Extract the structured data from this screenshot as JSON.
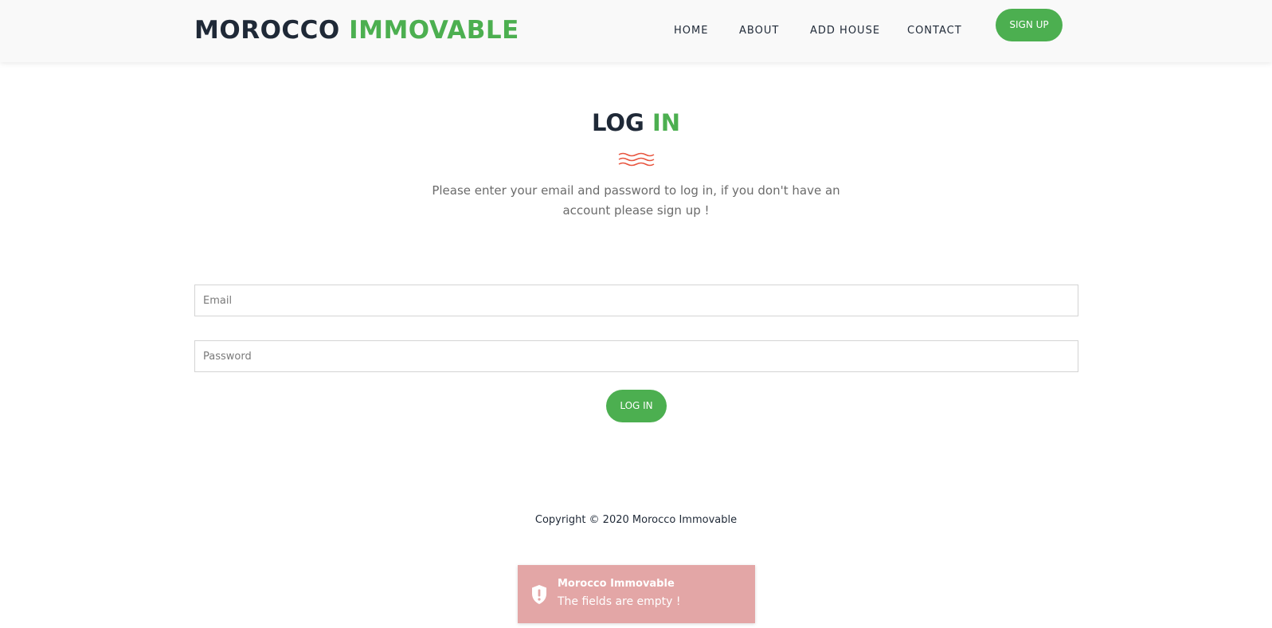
{
  "header": {
    "brand_part1": "MOROCCO",
    "brand_part2": "IMMOVABLE",
    "nav": {
      "home": "HOME",
      "about": "ABOUT",
      "add_house": "ADD HOUSE",
      "contact": "CONTACT"
    },
    "signup_label": "SIGN UP"
  },
  "main": {
    "title_part1": "LOG",
    "title_part2": "IN",
    "divider_icon": "wave-divider-icon",
    "subtitle": "Please enter your email and password to log in, if you don't have an account please sign up !",
    "email": {
      "value": "",
      "placeholder": "Email"
    },
    "password": {
      "value": "",
      "placeholder": "Password"
    },
    "login_label": "LOG IN"
  },
  "footer": {
    "copyright": "Copyright © 2020 Morocco Immovable"
  },
  "toast": {
    "icon": "shield-alert-icon",
    "title": "Morocco Immovable",
    "message": "The fields are empty !"
  },
  "colors": {
    "accent": "#4caf50",
    "dark": "#1f2937",
    "toast_bg": "#e3a6a6",
    "divider": "#e8553f"
  }
}
